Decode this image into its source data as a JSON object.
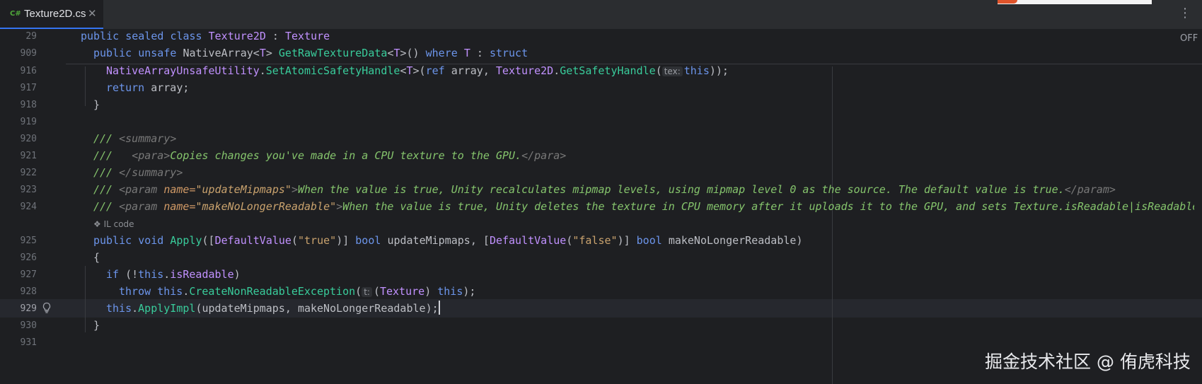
{
  "tab": {
    "lang_badge": "C#",
    "file_name": "Texture2D.cs",
    "close_glyph": "✕",
    "menu_glyph": "⋮"
  },
  "sticky": {
    "lines": [
      {
        "number": "29"
      },
      {
        "number": "909"
      }
    ]
  },
  "editor": {
    "status_label": "OFF",
    "il_code_label": "❖ IL code",
    "lines": [
      {
        "number": "916"
      },
      {
        "number": "917"
      },
      {
        "number": "918"
      },
      {
        "number": "919"
      },
      {
        "number": "920"
      },
      {
        "number": "921"
      },
      {
        "number": "922"
      },
      {
        "number": "923"
      },
      {
        "number": "924"
      },
      {
        "number": "925"
      },
      {
        "number": "926"
      },
      {
        "number": "927"
      },
      {
        "number": "928"
      },
      {
        "number": "929"
      },
      {
        "number": "930"
      },
      {
        "number": "931"
      }
    ]
  },
  "tokens": {
    "kw_public": "public",
    "kw_sealed": "sealed",
    "kw_class": "class",
    "kw_unsafe": "unsafe",
    "kw_ref": "ref",
    "kw_return": "return",
    "kw_where": "where",
    "kw_struct": "struct",
    "kw_void": "void",
    "kw_bool": "bool",
    "kw_if": "if",
    "kw_throw": "throw",
    "kw_this": "this",
    "type_texture2d": "Texture2D",
    "type_texture": "Texture",
    "type_nativearray": "NativeArray",
    "type_utility": "NativeArrayUnsafeUtility",
    "type_T": "T",
    "type_defaultvalue": "DefaultValue",
    "method_getrawtexturedata": "GetRawTextureData",
    "method_setatomicsafetyhandle": "SetAtomicSafetyHandle",
    "method_getsafetyhandle": "GetSafetyHandle",
    "method_apply": "Apply",
    "method_createnonreadableexception": "CreateNonReadableException",
    "method_applyimpl": "ApplyImpl",
    "ident_array": "array",
    "ident_isreadable": "isReadable",
    "ident_updatemipmaps": "updateMipmaps",
    "ident_makenolongerreadable": "makeNoLongerReadable",
    "str_true": "\"true\"",
    "str_false": "\"false\"",
    "hint_tex": "tex:",
    "hint_t": "t:",
    "comment_slashes": "///",
    "comment_summary_open": "<summary>",
    "comment_summary_close": "</summary>",
    "comment_para_open": "<para>",
    "comment_para_close": "</para>",
    "comment_para_text": "Copies changes you've made in a CPU texture to the GPU.",
    "comment_param_open_tag": "<param",
    "comment_param_close_tag": "</param>",
    "comment_attr_name": "name=",
    "comment_attr_updatemipmaps": "\"updateMipmaps\"",
    "comment_attr_makenolongerreadable": "\"makeNoLongerReadable\"",
    "comment_updatemipmaps_text": "When the value is true, Unity recalculates mipmap levels, using mipmap level 0 as the source. The default value is true.",
    "comment_makenolonger_text": "When the value is true, Unity deletes the texture in CPU memory after it uploads it to the GPU, and sets Texture.isReadable|isReadable"
  },
  "watermark": "掘金技术社区 @ 侑虎科技"
}
